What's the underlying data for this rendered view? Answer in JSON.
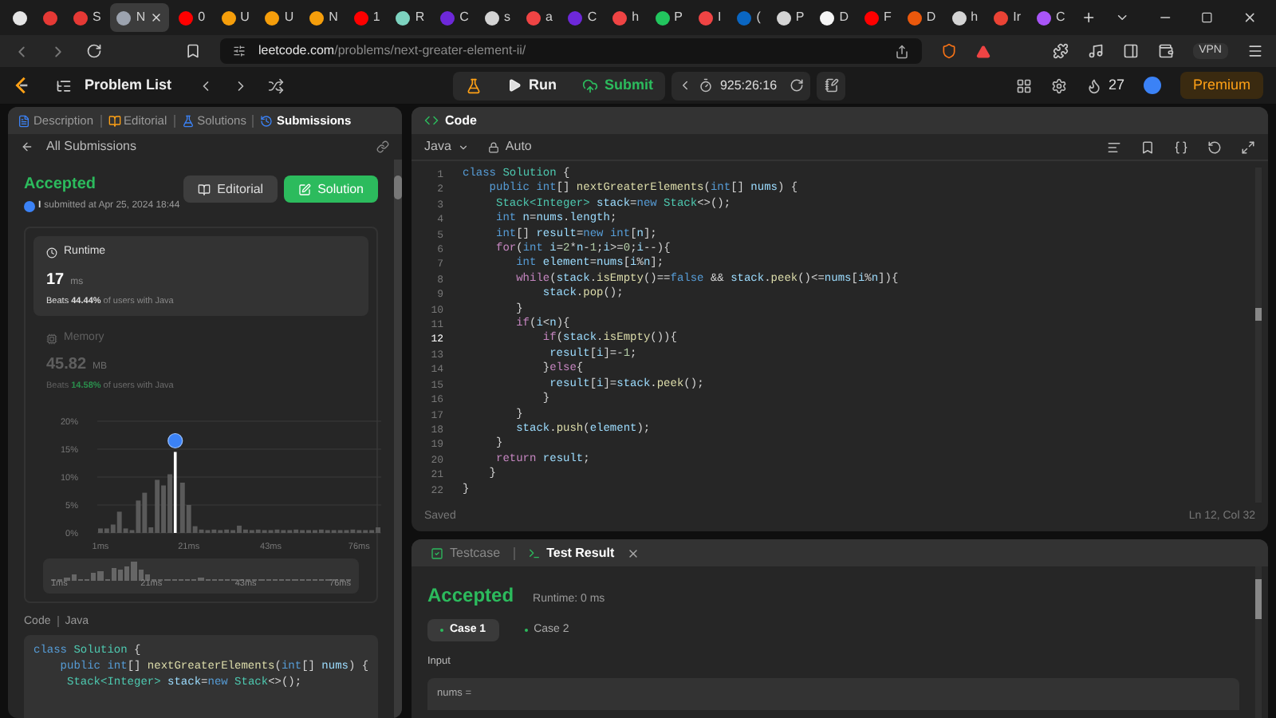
{
  "browser": {
    "tabs": [
      {
        "color": "#e5e5e5",
        "selected": false
      },
      {
        "color": "#e53935",
        "selected": false
      },
      {
        "label": "S",
        "color": "#e53935",
        "selected": false
      },
      {
        "label": "N",
        "color": "#9ca3af",
        "selected": true
      },
      {
        "label": "0",
        "color": "#ff0000",
        "selected": false
      },
      {
        "label": "U",
        "color": "#f59e0b",
        "selected": false
      },
      {
        "label": "U",
        "color": "#f59e0b",
        "selected": false
      },
      {
        "label": "N",
        "color": "#f59e0b",
        "selected": false
      },
      {
        "label": "1",
        "color": "#ff0000",
        "selected": false
      },
      {
        "label": "R",
        "color": "#7dd3c0",
        "selected": false
      },
      {
        "label": "C",
        "color": "#6d28d9",
        "selected": false
      },
      {
        "label": "s",
        "color": "#d4d4d4",
        "selected": false
      },
      {
        "label": "a",
        "color": "#ef4444",
        "selected": false
      },
      {
        "label": "C",
        "color": "#6d28d9",
        "selected": false
      },
      {
        "label": "h",
        "color": "#ef4444",
        "selected": false
      },
      {
        "label": "P",
        "color": "#22c55e",
        "selected": false
      },
      {
        "label": "I",
        "color": "#ef4444",
        "selected": false
      },
      {
        "label": "(",
        "color": "#0a66c2",
        "selected": false
      },
      {
        "label": "P",
        "color": "#d4d4d4",
        "selected": false
      },
      {
        "label": "D",
        "color": "#f5f5f5",
        "selected": false
      },
      {
        "label": "F",
        "color": "#ff0000",
        "selected": false
      },
      {
        "label": "D",
        "color": "#ea580c",
        "selected": false
      },
      {
        "label": "h",
        "color": "#d4d4d4",
        "selected": false
      },
      {
        "label": "Ir",
        "color": "#ea4335",
        "selected": false
      },
      {
        "label": "C",
        "color": "#a855f7",
        "selected": false
      }
    ],
    "url_host": "leetcode.com",
    "url_path": "/problems/next-greater-element-ii/",
    "vpn": "VPN"
  },
  "nav": {
    "problem_list": "Problem List",
    "run": "Run",
    "submit": "Submit",
    "timer": "925:26:16",
    "streak": "27",
    "premium": "Premium"
  },
  "left_tabs": [
    {
      "label": "Description",
      "selected": false
    },
    {
      "label": "Editorial",
      "selected": false
    },
    {
      "label": "Solutions",
      "selected": false
    },
    {
      "label": "Submissions",
      "selected": true
    }
  ],
  "back": "All Submissions",
  "submission": {
    "status": "Accepted",
    "user": "I",
    "submitted": "submitted at Apr 25, 2024 18:44",
    "buttons": [
      {
        "label": "Editorial",
        "kind": "secondary"
      },
      {
        "label": "Solution",
        "kind": "primary"
      }
    ]
  },
  "metrics": [
    {
      "kind": "runtime",
      "title": "Runtime",
      "value": "17",
      "unit": "ms",
      "beats_prefix": "Beats",
      "beats": "44.44%",
      "suffix": "of users with Java",
      "selected": true
    },
    {
      "kind": "memory",
      "title": "Memory",
      "value": "45.82",
      "unit": "MB",
      "beats_prefix": "Beats",
      "beats": "14.58%",
      "suffix": "of users with Java",
      "selected": false
    }
  ],
  "chart_data": {
    "type": "bar",
    "categories": [
      "1ms",
      null,
      null,
      null,
      null,
      null,
      null,
      null,
      null,
      null,
      null,
      null,
      null,
      null,
      "21ms",
      null,
      null,
      null,
      null,
      null,
      null,
      null,
      null,
      null,
      null,
      null,
      null,
      "43ms",
      null,
      null,
      null,
      null,
      null,
      null,
      null,
      null,
      null,
      null,
      null,
      null,
      null,
      "76ms",
      null,
      null,
      null
    ],
    "series": [
      {
        "color": "#5a5a5a",
        "values": [
          0.8,
          0.8,
          1.5,
          3.8,
          0.8,
          0.5,
          5.8,
          7.2,
          1.0,
          9.5,
          8.5,
          10.5,
          null,
          9.0,
          5.0,
          1.2,
          0.6,
          0.5,
          0.6,
          0.5,
          0.6,
          0.5,
          1.3,
          0.6,
          0.5,
          0.6,
          0.5,
          0.5,
          0.6,
          0.5,
          0.5,
          0.6,
          0.5,
          0.5,
          0.5,
          0.6,
          0.5,
          0.5,
          0.5,
          0.5,
          0.6,
          0.5,
          0.5,
          0.5,
          1.0
        ]
      },
      {
        "color": "#ffffff",
        "values": [
          null,
          null,
          null,
          null,
          null,
          null,
          null,
          null,
          null,
          null,
          null,
          null,
          14.5,
          null,
          null,
          null,
          null,
          null,
          null,
          null,
          null,
          null,
          null,
          null,
          null,
          null,
          null,
          null,
          null,
          null,
          null,
          null,
          null,
          null,
          null,
          null,
          null,
          null,
          null,
          null,
          null,
          null,
          null,
          null,
          null
        ]
      }
    ],
    "yticks": [
      {
        "value": 0,
        "label": "0%"
      },
      {
        "value": 5,
        "label": "5%"
      },
      {
        "value": 10,
        "label": "10%"
      },
      {
        "value": 15,
        "label": "15%"
      },
      {
        "value": 20,
        "label": "20%"
      }
    ],
    "ylim": [
      0,
      20
    ],
    "grid": true
  },
  "overview_labels": [
    "1ms",
    "21ms",
    "43ms",
    "76ms"
  ],
  "code_section": {
    "label": "Code",
    "language": "Java",
    "lines": [
      {
        "tokens": [
          {
            "kind": "k",
            "text": "class "
          },
          {
            "kind": "t",
            "text": "Solution"
          },
          {
            "kind": "p",
            "text": " {"
          }
        ]
      },
      {
        "tokens": [
          {
            "kind": "k",
            "text": "    public int"
          },
          {
            "kind": "p",
            "text": "[] "
          },
          {
            "kind": "f",
            "text": "nextGreaterElements"
          },
          {
            "kind": "p",
            "text": "("
          },
          {
            "kind": "k",
            "text": "int"
          },
          {
            "kind": "p",
            "text": "[] "
          },
          {
            "kind": "v",
            "text": "nums"
          },
          {
            "kind": "p",
            "text": ") {"
          }
        ]
      },
      {
        "tokens": [
          {
            "kind": "t",
            "text": "     Stack<Integer>"
          },
          {
            "kind": "v",
            "text": " stack"
          },
          {
            "kind": "p",
            "text": "="
          },
          {
            "kind": "k",
            "text": "new"
          },
          {
            "kind": "t",
            "text": " Stack"
          },
          {
            "kind": "p",
            "text": "<>();"
          }
        ]
      }
    ]
  },
  "editor": {
    "title": "Code",
    "language": "Java",
    "mode": "Auto",
    "status": "Saved",
    "cursor": "Ln 12, Col 32",
    "lines": [
      {
        "number": "1",
        "current": false,
        "tokens": [
          {
            "kind": "k",
            "text": "class "
          },
          {
            "kind": "t",
            "text": "Solution"
          },
          {
            "kind": "p",
            "text": " {"
          }
        ]
      },
      {
        "number": "2",
        "current": false,
        "tokens": [
          {
            "kind": "k",
            "text": "    public int"
          },
          {
            "kind": "p",
            "text": "[] "
          },
          {
            "kind": "f",
            "text": "nextGreaterElements"
          },
          {
            "kind": "p",
            "text": "("
          },
          {
            "kind": "k",
            "text": "int"
          },
          {
            "kind": "p",
            "text": "[] "
          },
          {
            "kind": "v",
            "text": "nums"
          },
          {
            "kind": "p",
            "text": ") {"
          }
        ]
      },
      {
        "number": "3",
        "current": false,
        "tokens": [
          {
            "kind": "t",
            "text": "     Stack<Integer>"
          },
          {
            "kind": "v",
            "text": " stack"
          },
          {
            "kind": "p",
            "text": "="
          },
          {
            "kind": "k",
            "text": "new"
          },
          {
            "kind": "t",
            "text": " Stack"
          },
          {
            "kind": "p",
            "text": "<>();"
          }
        ]
      },
      {
        "number": "4",
        "current": false,
        "tokens": [
          {
            "kind": "k",
            "text": "     int"
          },
          {
            "kind": "v",
            "text": " n"
          },
          {
            "kind": "p",
            "text": "="
          },
          {
            "kind": "v",
            "text": "nums"
          },
          {
            "kind": "p",
            "text": "."
          },
          {
            "kind": "v",
            "text": "length"
          },
          {
            "kind": "p",
            "text": ";"
          }
        ]
      },
      {
        "number": "5",
        "current": false,
        "tokens": [
          {
            "kind": "k",
            "text": "     int"
          },
          {
            "kind": "p",
            "text": "[] "
          },
          {
            "kind": "v",
            "text": "result"
          },
          {
            "kind": "p",
            "text": "="
          },
          {
            "kind": "k",
            "text": "new"
          },
          {
            "kind": "k",
            "text": " int"
          },
          {
            "kind": "p",
            "text": "["
          },
          {
            "kind": "v",
            "text": "n"
          },
          {
            "kind": "p",
            "text": "];"
          }
        ]
      },
      {
        "number": "6",
        "current": false,
        "tokens": [
          {
            "kind": "c",
            "text": "     for"
          },
          {
            "kind": "p",
            "text": "("
          },
          {
            "kind": "k",
            "text": "int"
          },
          {
            "kind": "v",
            "text": " i"
          },
          {
            "kind": "p",
            "text": "="
          },
          {
            "kind": "n",
            "text": "2"
          },
          {
            "kind": "p",
            "text": "*"
          },
          {
            "kind": "v",
            "text": "n"
          },
          {
            "kind": "p",
            "text": "-"
          },
          {
            "kind": "n",
            "text": "1"
          },
          {
            "kind": "p",
            "text": ";"
          },
          {
            "kind": "v",
            "text": "i"
          },
          {
            "kind": "p",
            "text": ">="
          },
          {
            "kind": "n",
            "text": "0"
          },
          {
            "kind": "p",
            "text": ";"
          },
          {
            "kind": "v",
            "text": "i"
          },
          {
            "kind": "p",
            "text": "--){"
          }
        ]
      },
      {
        "number": "7",
        "current": false,
        "tokens": [
          {
            "kind": "k",
            "text": "        int"
          },
          {
            "kind": "v",
            "text": " element"
          },
          {
            "kind": "p",
            "text": "="
          },
          {
            "kind": "v",
            "text": "nums"
          },
          {
            "kind": "p",
            "text": "["
          },
          {
            "kind": "v",
            "text": "i"
          },
          {
            "kind": "p",
            "text": "%"
          },
          {
            "kind": "v",
            "text": "n"
          },
          {
            "kind": "p",
            "text": "];"
          }
        ]
      },
      {
        "number": "8",
        "current": false,
        "tokens": [
          {
            "kind": "c",
            "text": "        while"
          },
          {
            "kind": "p",
            "text": "("
          },
          {
            "kind": "v",
            "text": "stack"
          },
          {
            "kind": "p",
            "text": "."
          },
          {
            "kind": "f",
            "text": "isEmpty"
          },
          {
            "kind": "p",
            "text": "()=="
          },
          {
            "kind": "k",
            "text": "false"
          },
          {
            "kind": "p",
            "text": " && "
          },
          {
            "kind": "v",
            "text": "stack"
          },
          {
            "kind": "p",
            "text": "."
          },
          {
            "kind": "f",
            "text": "peek"
          },
          {
            "kind": "p",
            "text": "()<="
          },
          {
            "kind": "v",
            "text": "nums"
          },
          {
            "kind": "p",
            "text": "["
          },
          {
            "kind": "v",
            "text": "i"
          },
          {
            "kind": "p",
            "text": "%"
          },
          {
            "kind": "v",
            "text": "n"
          },
          {
            "kind": "p",
            "text": "]){"
          }
        ]
      },
      {
        "number": "9",
        "current": false,
        "tokens": [
          {
            "kind": "v",
            "text": "            stack"
          },
          {
            "kind": "p",
            "text": "."
          },
          {
            "kind": "f",
            "text": "pop"
          },
          {
            "kind": "p",
            "text": "();"
          }
        ]
      },
      {
        "number": "10",
        "current": false,
        "tokens": [
          {
            "kind": "p",
            "text": "        }"
          }
        ]
      },
      {
        "number": "11",
        "current": false,
        "tokens": [
          {
            "kind": "c",
            "text": "        if"
          },
          {
            "kind": "p",
            "text": "("
          },
          {
            "kind": "v",
            "text": "i"
          },
          {
            "kind": "p",
            "text": "<"
          },
          {
            "kind": "v",
            "text": "n"
          },
          {
            "kind": "p",
            "text": "){"
          }
        ]
      },
      {
        "number": "12",
        "current": true,
        "tokens": [
          {
            "kind": "c",
            "text": "            if"
          },
          {
            "kind": "p",
            "text": "("
          },
          {
            "kind": "v",
            "text": "stack"
          },
          {
            "kind": "p",
            "text": "."
          },
          {
            "kind": "f",
            "text": "isEmpty"
          },
          {
            "kind": "p",
            "text": "()){"
          }
        ]
      },
      {
        "number": "13",
        "current": false,
        "tokens": [
          {
            "kind": "v",
            "text": "             result"
          },
          {
            "kind": "p",
            "text": "["
          },
          {
            "kind": "v",
            "text": "i"
          },
          {
            "kind": "p",
            "text": "]=-"
          },
          {
            "kind": "n",
            "text": "1"
          },
          {
            "kind": "p",
            "text": ";"
          }
        ]
      },
      {
        "number": "14",
        "current": false,
        "tokens": [
          {
            "kind": "p",
            "text": "            }"
          },
          {
            "kind": "c",
            "text": "else"
          },
          {
            "kind": "p",
            "text": "{"
          }
        ]
      },
      {
        "number": "15",
        "current": false,
        "tokens": [
          {
            "kind": "v",
            "text": "             result"
          },
          {
            "kind": "p",
            "text": "["
          },
          {
            "kind": "v",
            "text": "i"
          },
          {
            "kind": "p",
            "text": "]="
          },
          {
            "kind": "v",
            "text": "stack"
          },
          {
            "kind": "p",
            "text": "."
          },
          {
            "kind": "f",
            "text": "peek"
          },
          {
            "kind": "p",
            "text": "();"
          }
        ]
      },
      {
        "number": "16",
        "current": false,
        "tokens": [
          {
            "kind": "p",
            "text": "            }"
          }
        ]
      },
      {
        "number": "17",
        "current": false,
        "tokens": [
          {
            "kind": "p",
            "text": "        }"
          }
        ]
      },
      {
        "number": "18",
        "current": false,
        "tokens": [
          {
            "kind": "v",
            "text": "        stack"
          },
          {
            "kind": "p",
            "text": "."
          },
          {
            "kind": "f",
            "text": "push"
          },
          {
            "kind": "p",
            "text": "("
          },
          {
            "kind": "v",
            "text": "element"
          },
          {
            "kind": "p",
            "text": ");"
          }
        ]
      },
      {
        "number": "19",
        "current": false,
        "tokens": [
          {
            "kind": "p",
            "text": "     }"
          }
        ]
      },
      {
        "number": "20",
        "current": false,
        "tokens": [
          {
            "kind": "c",
            "text": "     return"
          },
          {
            "kind": "v",
            "text": " result"
          },
          {
            "kind": "p",
            "text": ";"
          }
        ]
      },
      {
        "number": "21",
        "current": false,
        "tokens": [
          {
            "kind": "p",
            "text": "    }"
          }
        ]
      },
      {
        "number": "22",
        "current": false,
        "tokens": [
          {
            "kind": "p",
            "text": "}"
          }
        ]
      }
    ]
  },
  "result": {
    "tabs": [
      {
        "label": "Testcase",
        "selected": false
      },
      {
        "label": "Test Result",
        "selected": true
      }
    ],
    "status": "Accepted",
    "runtime": "Runtime: 0 ms",
    "cases": [
      {
        "label": "Case 1",
        "selected": true
      },
      {
        "label": "Case 2",
        "selected": false
      }
    ],
    "input_label": "Input",
    "input": "nums ="
  }
}
